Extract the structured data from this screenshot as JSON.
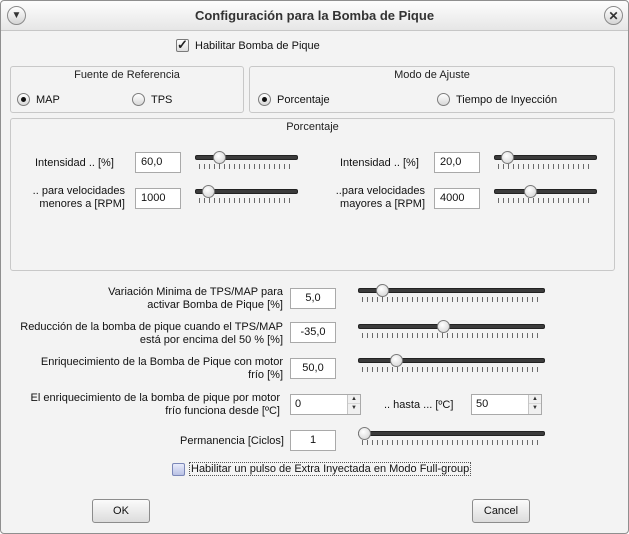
{
  "window": {
    "title": "Configuración para la Bomba de Pique"
  },
  "enable_checkbox": {
    "label": "Habilitar Bomba de Pique",
    "checked": true
  },
  "fuente": {
    "title": "Fuente de Referencia",
    "options": [
      {
        "label": "MAP",
        "selected": true
      },
      {
        "label": "TPS",
        "selected": false
      }
    ]
  },
  "modo": {
    "title": "Modo de Ajuste",
    "options": [
      {
        "label": "Porcentaje",
        "selected": true
      },
      {
        "label": "Tiempo de Inyección",
        "selected": false
      }
    ]
  },
  "porcentaje": {
    "title": "Porcentaje",
    "left": {
      "intensity_label": "Intensidad .. [%]",
      "intensity_value": "60,0",
      "intensity_slider": 0.2,
      "rpm_label_1": ".. para velocidades",
      "rpm_label_2": "menores a [RPM]",
      "rpm_value": "1000",
      "rpm_slider": 0.08
    },
    "right": {
      "intensity_label": "Intensidad .. [%]",
      "intensity_value": "20,0",
      "intensity_slider": 0.08,
      "rpm_label_1": "..para velocidades",
      "rpm_label_2": "mayores a [RPM]",
      "rpm_value": "4000",
      "rpm_slider": 0.33
    }
  },
  "settings": {
    "variacion": {
      "label_1": "Variación Minima de TPS/MAP para",
      "label_2": "activar Bomba de Pique  [%]",
      "value": "5,0",
      "slider": 0.1
    },
    "reduccion": {
      "label_1": "Reducción de la bomba de pique cuando el TPS/MAP",
      "label_2": "está por encima del 50 % [%]",
      "value": "-35,0",
      "slider": 0.45
    },
    "enriquecimiento": {
      "label_1": "Enriquecimiento de la Bomba de Pique con motor",
      "label_2": "frío [%]",
      "value": "50,0",
      "slider": 0.18
    },
    "frio": {
      "label_1": "El enriquecimiento de la bomba de pique por motor",
      "label_2": "frío funciona desde [ºC]",
      "from_value": "0",
      "hasta_label": ".. hasta ... [ºC]",
      "to_value": "50"
    },
    "permanencia": {
      "label": "Permanencia [Ciclos]",
      "value": "1",
      "slider": 0.0
    }
  },
  "extra_checkbox": {
    "label": "Habilitar un pulso de Extra Inyectada en Modo Full-group",
    "checked": false
  },
  "buttons": {
    "ok": "OK",
    "cancel": "Cancel"
  }
}
